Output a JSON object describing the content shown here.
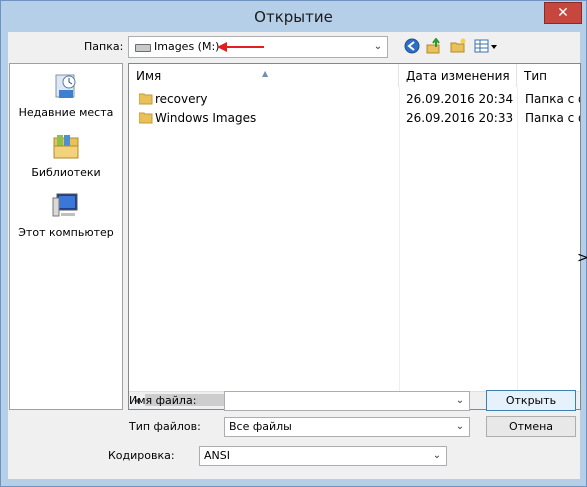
{
  "window": {
    "title": "Открытие",
    "close_glyph": "✕"
  },
  "toolbar": {
    "folder_label": "Папка:",
    "folder_value": "Images (M:)",
    "icons": [
      "back-icon",
      "up-folder-icon",
      "new-folder-icon",
      "view-menu-icon"
    ]
  },
  "places": [
    {
      "label": "Недавние места",
      "icon": "recent-places-icon"
    },
    {
      "label": "Библиотеки",
      "icon": "libraries-icon"
    },
    {
      "label": "Этот компьютер",
      "icon": "computer-icon"
    }
  ],
  "filelist": {
    "columns": [
      "Имя",
      "Дата изменения",
      "Тип"
    ],
    "rows": [
      {
        "name": "recovery",
        "date": "26.09.2016 20:34",
        "type": "Папка с ф"
      },
      {
        "name": "Windows Images",
        "date": "26.09.2016 20:33",
        "type": "Папка с ф"
      }
    ]
  },
  "form": {
    "filename_label": "Имя файла:",
    "filename_value": "",
    "filetype_label": "Тип файлов:",
    "filetype_value": "Все файлы",
    "encoding_label": "Кодировка:",
    "encoding_value": "ANSI",
    "open_button": "Открыть",
    "cancel_button": "Отмена"
  },
  "colors": {
    "frame": "#b5cfe8",
    "close": "#c7463e",
    "folder_yellow": "#e8c15a",
    "annotation_arrow": "#e02020"
  }
}
